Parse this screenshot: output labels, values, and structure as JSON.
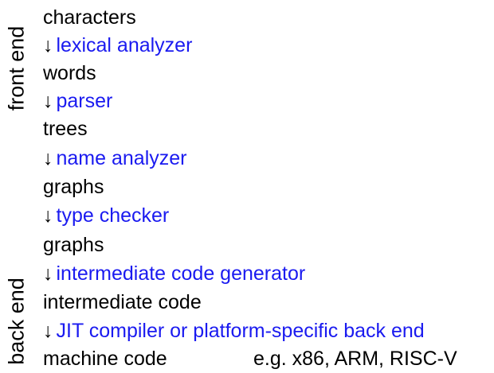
{
  "side_labels": {
    "front_end": "front end",
    "back_end": "back end"
  },
  "arrow_glyph": "↓",
  "colors": {
    "stage": "#1a1af0",
    "data": "#000000"
  },
  "pipeline": [
    {
      "kind": "data",
      "text": "characters"
    },
    {
      "kind": "stage",
      "text": "lexical analyzer"
    },
    {
      "kind": "data",
      "text": "words"
    },
    {
      "kind": "stage",
      "text": "parser"
    },
    {
      "kind": "data",
      "text": "trees"
    },
    {
      "kind": "stage",
      "text": "name analyzer"
    },
    {
      "kind": "data",
      "text": "graphs"
    },
    {
      "kind": "stage",
      "text": "type checker"
    },
    {
      "kind": "data",
      "text": "graphs"
    },
    {
      "kind": "stage",
      "text": "intermediate code generator"
    },
    {
      "kind": "data",
      "text": "intermediate code"
    },
    {
      "kind": "stage",
      "text": "JIT compiler or platform-specific back end"
    },
    {
      "kind": "data",
      "text": "machine code"
    }
  ],
  "machine_code_example": "e.g. x86, ARM, RISC-V"
}
